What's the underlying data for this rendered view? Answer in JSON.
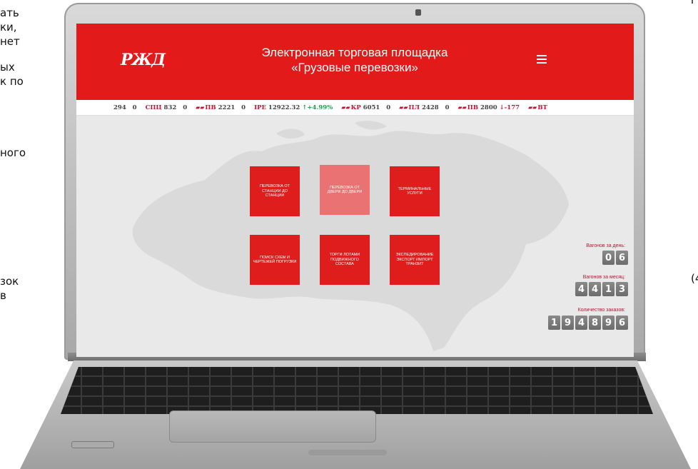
{
  "side_left": [
    "ать",
    "ки,",
    "нет",
    "",
    "ых",
    "",
    "к по",
    "",
    "",
    "",
    "ного",
    "",
    "",
    "",
    "",
    "",
    "",
    "",
    "",
    "зок",
    "в"
  ],
  "side_right": [
    "г",
    "(4"
  ],
  "app": {
    "logo": "РЖД",
    "title_line1": "Электронная торговая площадка",
    "title_line2": "«Грузовые перевозки»",
    "menu_icon": "hamburger-icon"
  },
  "ticker": [
    {
      "label": "294",
      "value": "0"
    },
    {
      "label": "СПЦ",
      "num": "832",
      "value": "0"
    },
    {
      "icon": "wagon-icon",
      "label": "ПВ",
      "num": "2221",
      "value": "0"
    },
    {
      "label": "IPE",
      "num": "12922.32",
      "change": "↑+4.99%",
      "dir": "up"
    },
    {
      "icon": "wagon-icon",
      "label": "КР",
      "num": "6051",
      "value": "0"
    },
    {
      "icon": "wagon-icon",
      "label": "ПЛ",
      "num": "2428",
      "value": "0"
    },
    {
      "icon": "wagon-icon",
      "label": "ПВ",
      "num": "2800",
      "change": "↓-177",
      "dir": "down"
    },
    {
      "icon": "wagon-icon",
      "label": "ВТ"
    }
  ],
  "tiles": [
    {
      "text": "ПЕРЕВОЗКА ОТ СТАНЦИИ ДО СТАНЦИИ"
    },
    {
      "text": "ПЕРЕВОЗКА ОТ ДВЕРИ ДО ДВЕРИ"
    },
    {
      "text": "ТЕРМИНАЛЬНЫЕ УСЛУГИ"
    },
    {
      "text": "ПОИСК СХЕМ И ЧЕРТЕЖЕЙ ПОГРУЗКИ"
    },
    {
      "text": "ТОРГИ ЛОТАМИ ПОДВИЖНОГО СОСТАВА"
    },
    {
      "text": "ЭКСПЕДИРОВАНИЕ ЭКСПОРТ ИМПОРТ ТРАНЗИТ"
    }
  ],
  "counters": [
    {
      "label": "Вагонов за день:",
      "digits": [
        "0",
        "6"
      ]
    },
    {
      "label": "Вагонов за месяц:",
      "digits": [
        "4",
        "4",
        "1",
        "3"
      ]
    },
    {
      "label": "Количество заказов:",
      "digits": [
        "1",
        "9",
        "4",
        "8",
        "9",
        "6"
      ]
    }
  ],
  "colors": {
    "brand_red": "#e21a1a",
    "up_green": "#1aa34a",
    "counter_grey": "#777777"
  }
}
